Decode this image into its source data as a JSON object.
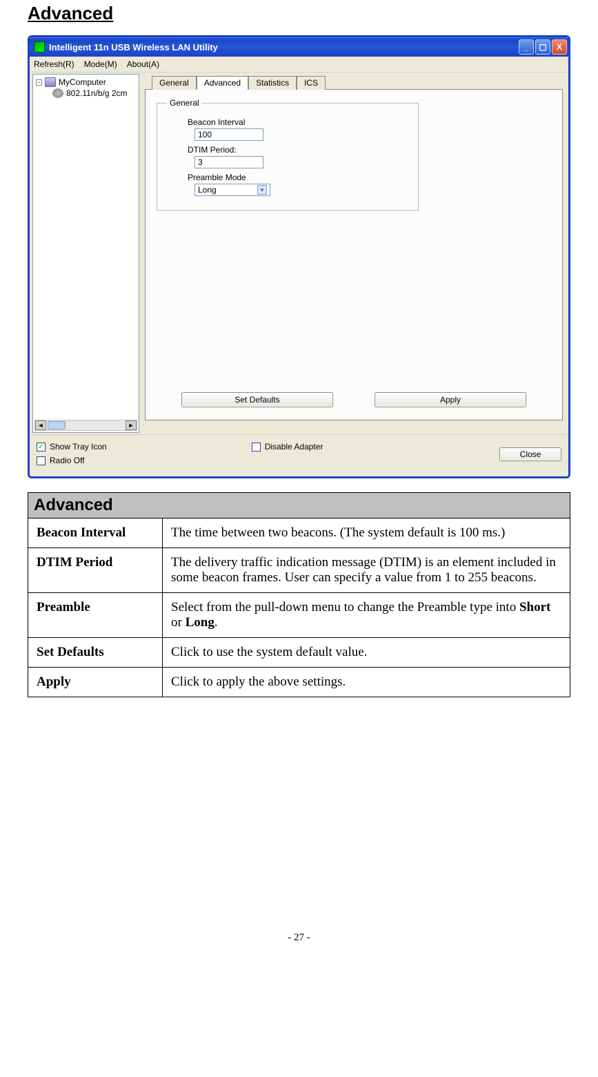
{
  "page": {
    "heading": "Advanced",
    "page_number": "- 27 -"
  },
  "window": {
    "title": "Intelligent 11n USB Wireless LAN Utility",
    "menu": {
      "refresh": "Refresh(R)",
      "mode": "Mode(M)",
      "about": "About(A)"
    },
    "tree": {
      "root": "MyComputer",
      "child": "802.11n/b/g 2cm"
    },
    "tabs": {
      "general": "General",
      "advanced": "Advanced",
      "statistics": "Statistics",
      "ics": "ICS"
    },
    "group": {
      "title": "General",
      "beacon_label": "Beacon Interval",
      "beacon_value": "100",
      "dtim_label": "DTIM Period:",
      "dtim_value": "3",
      "preamble_label": "Preamble Mode",
      "preamble_value": "Long"
    },
    "buttons": {
      "set_defaults": "Set Defaults",
      "apply": "Apply",
      "close": "Close"
    },
    "checks": {
      "show_tray": "Show Tray Icon",
      "radio_off": "Radio Off",
      "disable_adapter": "Disable Adapter"
    }
  },
  "doc": {
    "section": "Advanced",
    "rows": {
      "beacon": {
        "label": "Beacon Interval",
        "desc": "The time between two beacons. (The system default is 100 ms.)"
      },
      "dtim": {
        "label": "DTIM Period",
        "desc": "The delivery traffic indication message (DTIM) is an element included in some beacon frames. User can specify a value from 1 to 255 beacons."
      },
      "preamble": {
        "label": "Preamble",
        "desc_pre": "Select from the pull-down menu to change the Preamble type into ",
        "bold1": "Short",
        "mid": " or ",
        "bold2": "Long",
        "desc_post": "."
      },
      "setdef": {
        "label": "Set Defaults",
        "desc": "Click to use the system default value."
      },
      "apply": {
        "label": "Apply",
        "desc": "Click to apply the above settings."
      }
    }
  }
}
